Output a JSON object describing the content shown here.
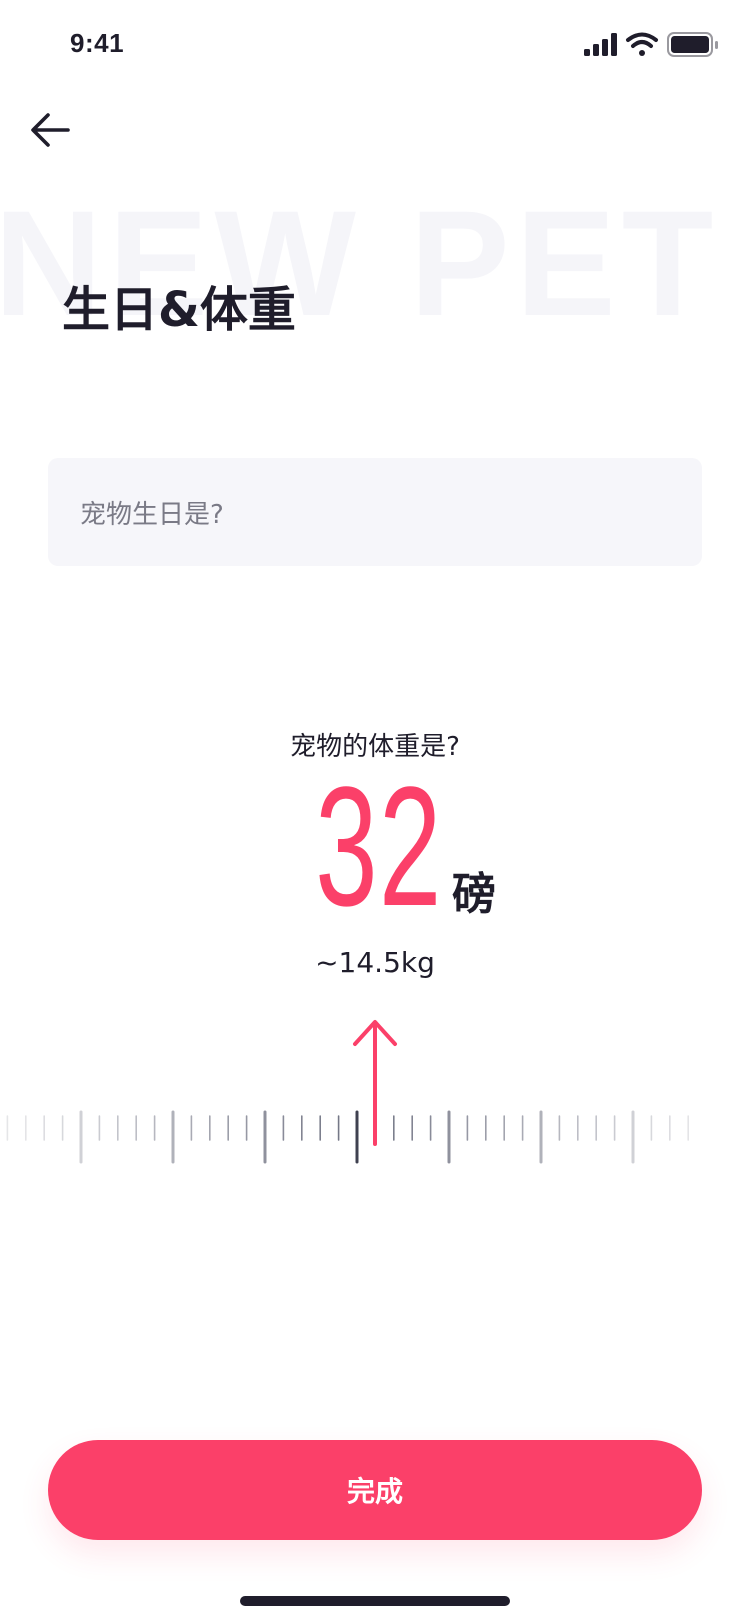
{
  "status_bar": {
    "time": "9:41",
    "icons": [
      "cellular-signal-icon",
      "wifi-icon",
      "battery-icon"
    ]
  },
  "nav": {
    "back_icon": "arrow-left-icon"
  },
  "header": {
    "watermark": "NEW PET",
    "title": "生日&体重"
  },
  "birthday": {
    "placeholder": "宠物生日是?"
  },
  "weight": {
    "question": "宠物的体重是?",
    "value": "32",
    "unit": "磅",
    "converted": "~14.5kg",
    "pointer_icon": "arrow-up-icon"
  },
  "actions": {
    "done_label": "完成"
  },
  "colors": {
    "accent": "#fb4069",
    "text": "#1f1d2b",
    "field_bg": "#f6f6fa",
    "watermark": "#f5f5f9",
    "placeholder": "#7a7a86"
  }
}
